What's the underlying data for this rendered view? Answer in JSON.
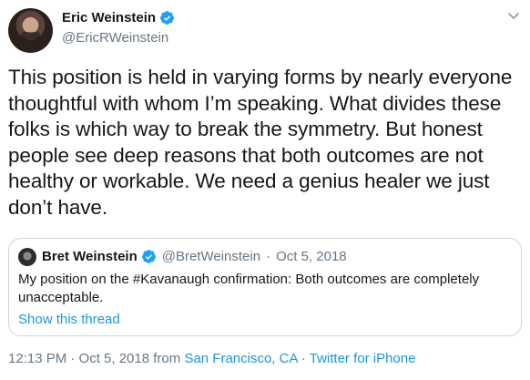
{
  "author": {
    "name": "Eric Weinstein",
    "handle": "@EricRWeinstein",
    "verified_icon": "verified-badge-icon"
  },
  "tweet": {
    "text": "This position is held in varying forms by nearly everyone thoughtful with whom I’m speaking. What divides these folks is which way to break the symmetry. But honest people see deep reasons that both outcomes are not healthy or workable. We need a genius healer we just don’t have."
  },
  "quoted_tweet": {
    "name": "Bret Weinstein",
    "handle": "@BretWeinstein",
    "separator": "·",
    "date": "Oct 5, 2018",
    "text": "My position on the #Kavanaugh confirmation: Both outcomes are completely unacceptable.",
    "show_thread_label": "Show this thread"
  },
  "footer": {
    "time_date": "12:13 PM · Oct 5, 2018 from",
    "location": "San Francisco, CA",
    "separator": "·",
    "source": "Twitter for iPhone"
  },
  "colors": {
    "link": "#1b95e0",
    "secondary_text": "#657786",
    "verified": "#1da1f2",
    "border": "#ccd6dd"
  }
}
